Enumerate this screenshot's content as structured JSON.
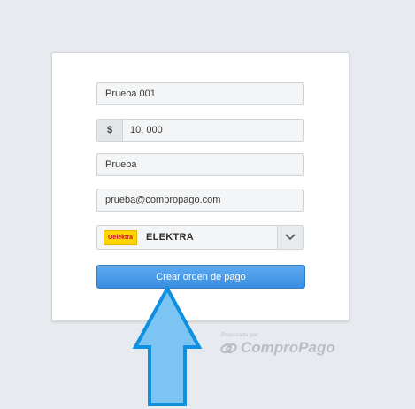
{
  "form": {
    "concept": "Prueba 001",
    "amount_prefix": "$",
    "amount": "10, 000",
    "name": "Prueba",
    "email": "prueba@compropago.com",
    "store": {
      "logo_text": "Oelektra",
      "label": "ELEKTRA"
    },
    "submit_label": "Crear orden de pago"
  },
  "branding": {
    "caption": "Procesado por:",
    "name": "ComproPago"
  },
  "colors": {
    "button": "#3a8ee0",
    "arrow_fill": "#7cc4f2",
    "arrow_stroke": "#0f8fe0",
    "store_logo_bg": "#ffd400"
  },
  "icons": {
    "select_arrow": "chevron-down-icon",
    "pointer": "up-arrow-icon",
    "brand": "compropago-logo-icon"
  }
}
